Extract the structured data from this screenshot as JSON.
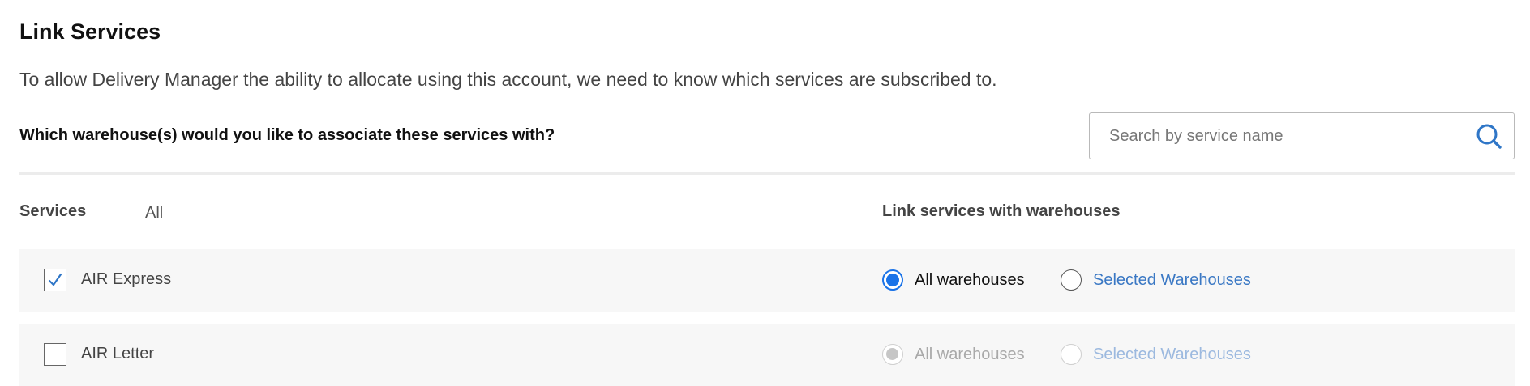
{
  "header": {
    "title": "Link Services",
    "description": "To allow Delivery Manager the ability to allocate using this account, we need to know which services are subscribed to.",
    "question": "Which warehouse(s) would you like to associate these services with?"
  },
  "search": {
    "placeholder": "Search by service name",
    "value": "",
    "icon": "search-icon"
  },
  "table": {
    "services_header": "Services",
    "all_label": "All",
    "all_checked": false,
    "link_header": "Link services with warehouses",
    "rows": [
      {
        "service": "AIR Express",
        "checked": true,
        "option_all": "All warehouses",
        "option_selected": "Selected Warehouses",
        "selected_option": "all",
        "enabled": true
      },
      {
        "service": "AIR Letter",
        "checked": false,
        "option_all": "All warehouses",
        "option_selected": "Selected Warehouses",
        "selected_option": "all",
        "enabled": false
      }
    ]
  },
  "colors": {
    "accent": "#1a73e8",
    "link": "#3a78c4",
    "row_background": "#f7f7f7",
    "disabled_text": "#a9a9a9"
  }
}
